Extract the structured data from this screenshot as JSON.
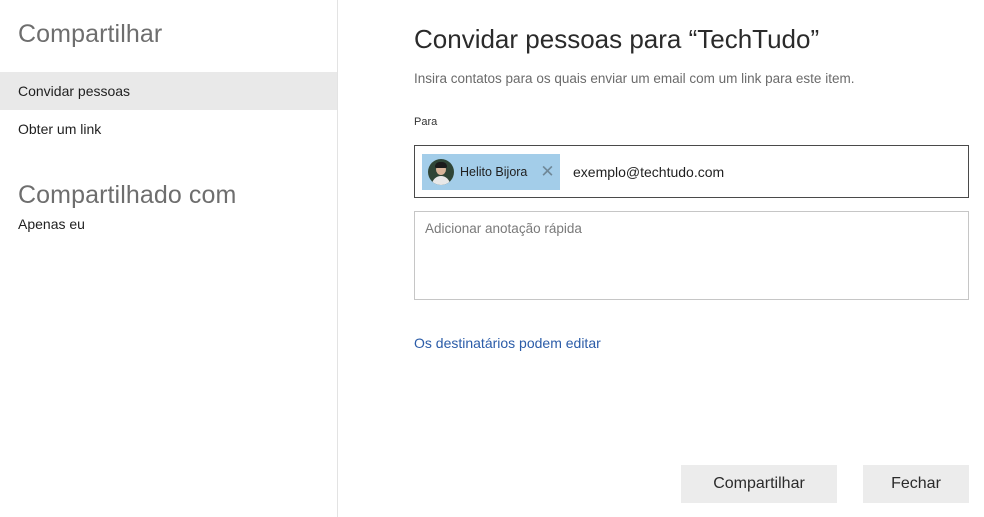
{
  "sidebar": {
    "share_heading": "Compartilhar",
    "items": [
      {
        "label": "Convidar pessoas",
        "active": true
      },
      {
        "label": "Obter um link",
        "active": false
      }
    ],
    "shared_with_heading": "Compartilhado com",
    "shared_with_value": "Apenas eu"
  },
  "main": {
    "title": "Convidar pessoas para “TechTudo”",
    "subtitle": "Insira contatos para os quais enviar um email com um link para este item.",
    "to_label": "Para",
    "recipients": [
      {
        "name": "Helito Bijora",
        "remove_icon": "close-icon"
      }
    ],
    "to_input_value": "exemplo@techtudo.com",
    "note_placeholder": "Adicionar anotação rápida",
    "permission_link": "Os destinatários podem editar",
    "buttons": {
      "share": "Compartilhar",
      "close": "Fechar"
    }
  },
  "colors": {
    "chip_background": "#a3cde9",
    "link": "#2b5ca8",
    "active_item": "#e9e9e9",
    "button": "#ececec"
  }
}
